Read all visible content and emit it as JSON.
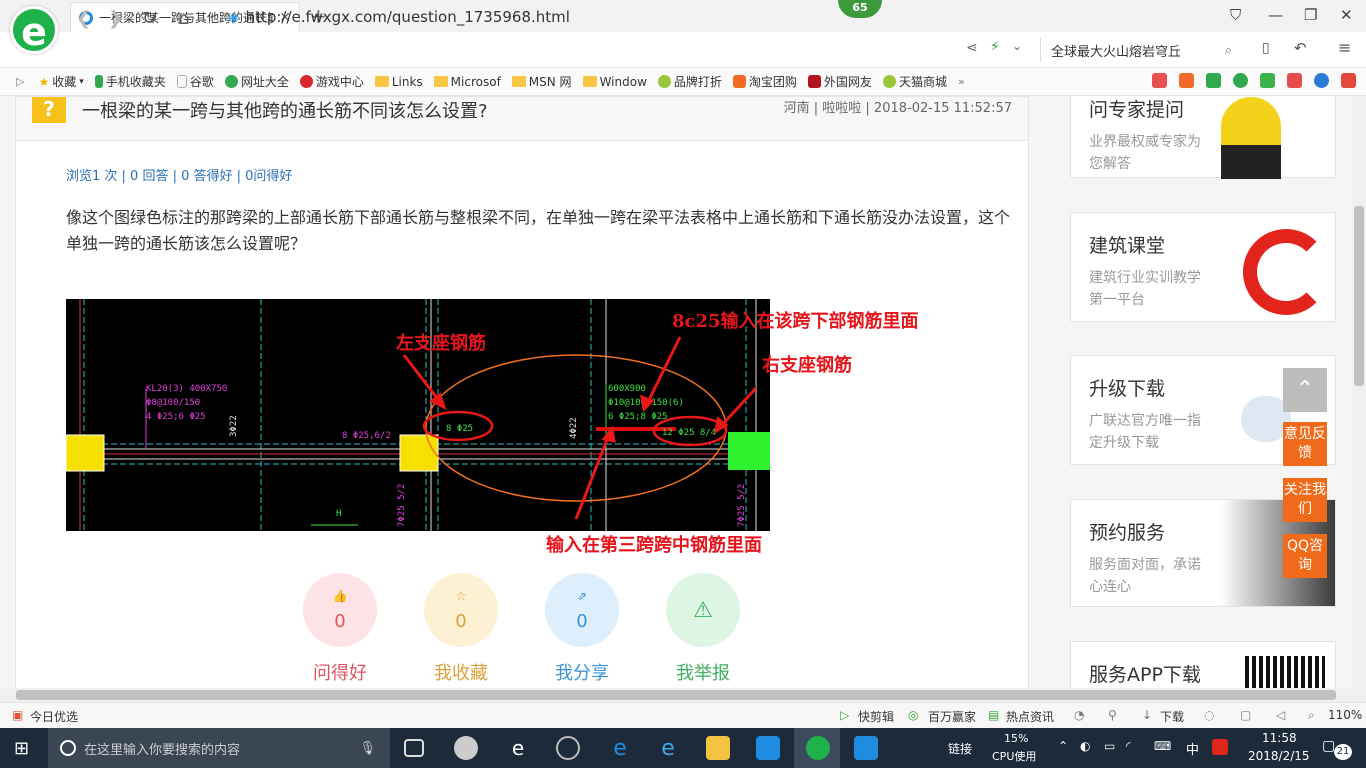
{
  "browser": {
    "tab_title": "一根梁的某一跨与其他跨的通长筋",
    "badge": "65",
    "url": "http://e.fwxgx.com/question_1735968.html",
    "search_text": "全球最大火山熔岩穹丘"
  },
  "bookmarks": [
    "收藏",
    "手机收藏夹",
    "谷歌",
    "网址大全",
    "游戏中心",
    "Links",
    "Microsof",
    "MSN 网",
    "Window",
    "品牌打折",
    "淘宝团购",
    "外国网友",
    "天猫商城"
  ],
  "question": {
    "title": "一根梁的某一跨与其他跨的通长筋不同该怎么设置?",
    "meta": "河南 | 啦啦啦 | 2018-02-15 11:52:57",
    "stats": "浏览1 次 | 0 回答 | 0 答得好 | 0问得好",
    "body": "像这个图绿色标注的那跨梁的上部通长筋下部通长筋与整根梁不同，在单独一跨在梁平法表格中上通长筋和下通长筋没办法设置，这个单独一跨的通长筋该怎么设置呢？"
  },
  "figure": {
    "annotations": {
      "left_support": "左支座钢筋",
      "bottom_input": "8c25输入在该跨下部钢筋里面",
      "right_support": "右支座钢筋",
      "middle_input": "输入在第三跨跨中钢筋里面"
    },
    "cad_text": {
      "beam1": "KL20(3) 400X750",
      "beam1_l2": "Φ8@100/150",
      "beam1_l3": "4 Φ25;6 Φ25",
      "dim1": "3Φ22",
      "rebar1": "8 Φ25,6/2",
      "circle1": "8 Φ25",
      "beam2": "600X900",
      "beam2_l2": "Φ10@100/150(6)",
      "beam2_l3": "6 Φ25;8 Φ25",
      "dim2": "4Φ22",
      "circle2": "12 Φ25 8/4",
      "vert1": "7Φ25 5/2",
      "vert2": "7Φ25 5/2",
      "label_h": "H"
    }
  },
  "actions": [
    {
      "label": "问得好",
      "count": "0",
      "color": "#e0555f",
      "bg": "#fde3e5"
    },
    {
      "label": "我收藏",
      "count": "0",
      "color": "#d9a23a",
      "bg": "#fdf0d3"
    },
    {
      "label": "我分享",
      "count": "0",
      "color": "#3b93d6",
      "bg": "#ddeefc"
    },
    {
      "label": "我举报",
      "count": "",
      "color": "#3fae5f",
      "bg": "#ddf5e3"
    }
  ],
  "sidebar": {
    "cards": [
      {
        "title": "问专家提问",
        "desc": "业界最权威专家为您解答"
      },
      {
        "title": "建筑课堂",
        "desc": "建筑行业实训教学第一平台"
      },
      {
        "title": "升级下载",
        "desc": "广联达官方唯一指定升级下载"
      },
      {
        "title": "预约服务",
        "desc": "服务面对面，承诺心连心"
      },
      {
        "title": "服务APP下载",
        "desc": ""
      }
    ],
    "floats": [
      "意见反馈",
      "关注我们",
      "QQ咨询"
    ]
  },
  "statusbar": {
    "left": "今日优选",
    "items": [
      "快剪辑",
      "百万赢家",
      "热点资讯",
      "下载"
    ],
    "zoom": "110%"
  },
  "taskbar": {
    "search_placeholder": "在这里输入你要搜索的内容",
    "link": "链接",
    "cpu": "15%",
    "cpu_label": "CPU使用",
    "ime": "中",
    "time": "11:58",
    "date": "2018/2/15",
    "notif": "21"
  }
}
